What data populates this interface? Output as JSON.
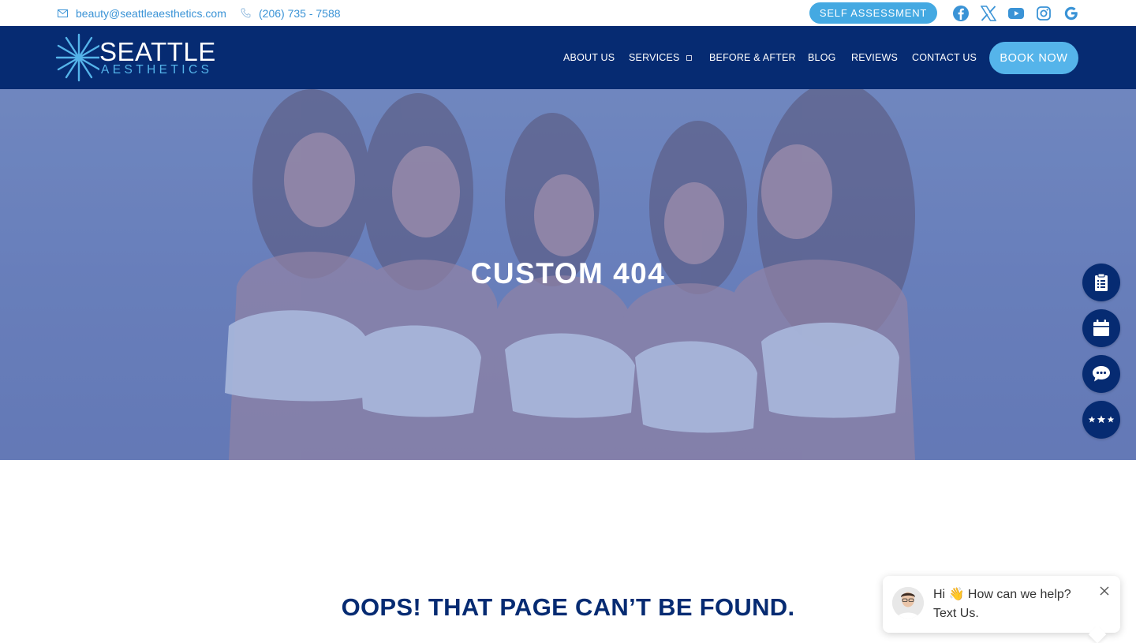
{
  "topbar": {
    "email": "beauty@seattleaesthetics.com",
    "phone": "(206) 735 - 7588",
    "self_assessment": "SELF ASSESSMENT",
    "socials": [
      "facebook-icon",
      "x-twitter-icon",
      "youtube-icon",
      "instagram-icon",
      "google-icon"
    ]
  },
  "nav": {
    "logo_line1": "SEATTLE",
    "logo_line2": "AESTHETICS",
    "items": [
      {
        "label": "ABOUT US"
      },
      {
        "label": "SERVICES",
        "dropdown": true
      },
      {
        "label": "BEFORE & AFTER"
      },
      {
        "label": "BLOG"
      },
      {
        "label": "REVIEWS"
      },
      {
        "label": "CONTACT US"
      }
    ],
    "book_now": "BOOK NOW"
  },
  "hero": {
    "title": "CUSTOM 404"
  },
  "side_buttons": [
    "clipboard-icon",
    "calendar-icon",
    "chat-icon",
    "stars-icon"
  ],
  "main": {
    "error_heading": "OOPS! THAT PAGE CAN’T BE FOUND."
  },
  "chat_widget": {
    "message_line1": "Hi 👋 How can we help?",
    "message_line2": "Text Us."
  },
  "colors": {
    "navy": "#062b72",
    "accent": "#55b4ea",
    "link": "#3a93d6"
  }
}
